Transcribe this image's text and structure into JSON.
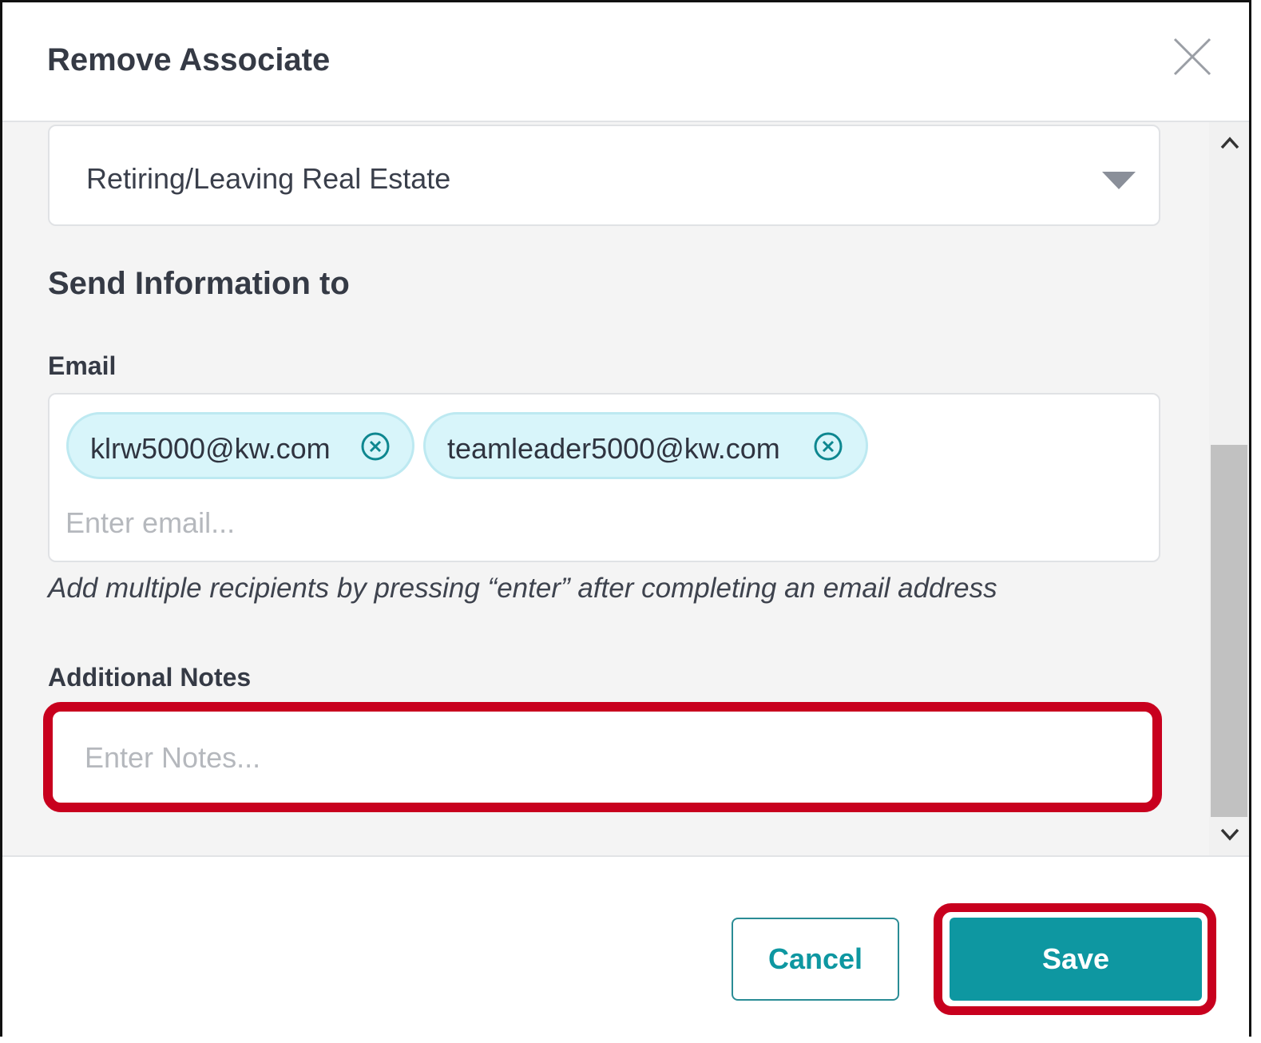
{
  "dialog": {
    "title": "Remove Associate"
  },
  "reason_select": {
    "value": "Retiring/Leaving Real Estate"
  },
  "send_info": {
    "title": "Send Information to",
    "email_label": "Email",
    "recipients": [
      "klrw5000@kw.com",
      "teamleader5000@kw.com"
    ],
    "email_placeholder": "Enter email...",
    "hint": "Add multiple recipients by pressing “enter” after completing an email address"
  },
  "notes": {
    "label": "Additional Notes",
    "placeholder": "Enter Notes..."
  },
  "footer": {
    "cancel_label": "Cancel",
    "save_label": "Save"
  },
  "colors": {
    "accent": "#0e97a1",
    "chip_background": "#d8f5fa",
    "highlight": "#c8001e"
  },
  "icons": {
    "close": "close-icon",
    "dropdown": "caret-down-icon",
    "chip_remove": "circle-x-icon",
    "scroll_up": "chevron-up-icon",
    "scroll_down": "chevron-down-icon"
  }
}
